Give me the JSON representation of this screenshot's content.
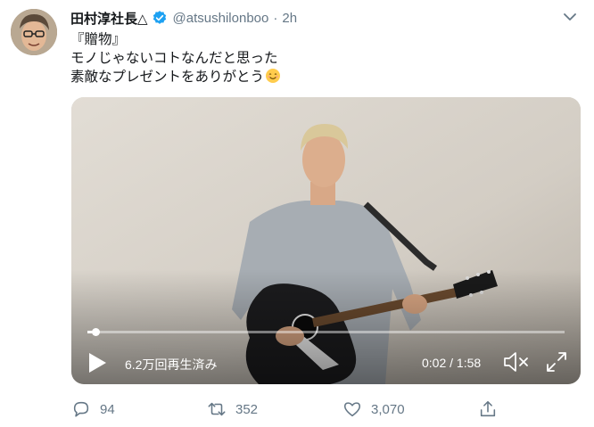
{
  "tweet": {
    "display_name": "田村淳社長△",
    "handle": "@atsushilonboo",
    "separator": "·",
    "time": "2h",
    "text_lines": [
      "『贈物』",
      "モノじゃないコトなんだと思った",
      "素敵なプレゼントをありがとう"
    ],
    "emoji": "smiling-face-emoji"
  },
  "video": {
    "views": "6.2万回再生済み",
    "timecode": "0:02 / 1:58",
    "progress": 0.017
  },
  "actions": {
    "replies": "94",
    "retweets": "352",
    "likes": "3,070"
  },
  "colors": {
    "verified": "#1da1f2",
    "secondary_text": "#657786",
    "primary_text": "#14171a"
  },
  "icons": [
    "verified-badge-icon",
    "chevron-down-icon",
    "play-icon",
    "mute-icon",
    "fullscreen-icon",
    "reply-icon",
    "retweet-icon",
    "like-icon",
    "share-icon"
  ]
}
